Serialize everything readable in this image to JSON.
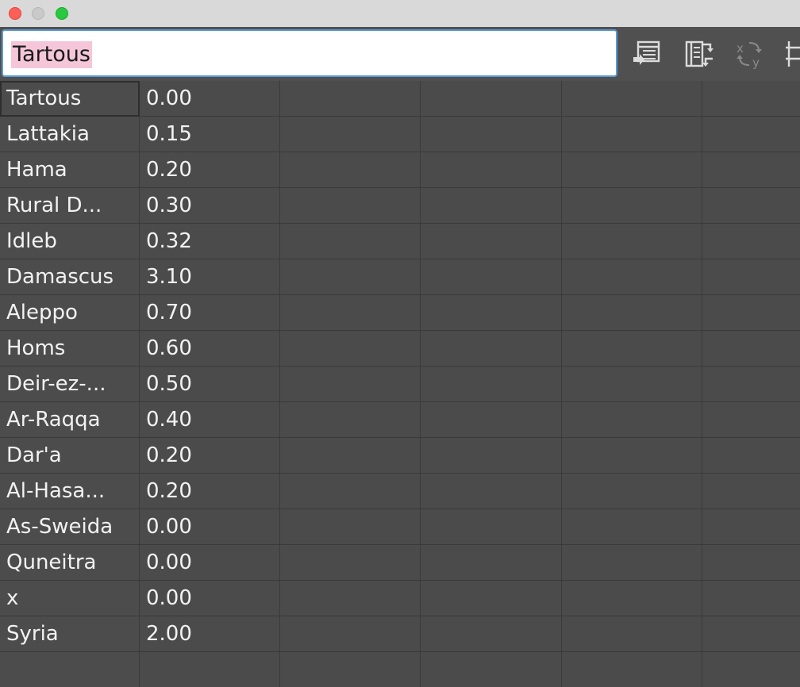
{
  "toolbar": {
    "input_value": "Tartous",
    "buttons": [
      {
        "name": "insert-table-icon"
      },
      {
        "name": "transpose-table-icon"
      },
      {
        "name": "swap-xy-icon"
      },
      {
        "name": "move-columns-icon"
      }
    ]
  },
  "table": {
    "rows": [
      {
        "name": "Tartous",
        "value": "0.00"
      },
      {
        "name": "Lattakia",
        "value": "0.15"
      },
      {
        "name": "Hama",
        "value": "0.20"
      },
      {
        "name": "Rural D...",
        "value": "0.30"
      },
      {
        "name": "Idleb",
        "value": "0.32"
      },
      {
        "name": "Damascus",
        "value": "3.10"
      },
      {
        "name": "Aleppo",
        "value": "0.70"
      },
      {
        "name": "Homs",
        "value": "0.60"
      },
      {
        "name": "Deir-ez-...",
        "value": "0.50"
      },
      {
        "name": "Ar-Raqqa",
        "value": "0.40"
      },
      {
        "name": "Dar'a",
        "value": "0.20"
      },
      {
        "name": "Al-Hasa...",
        "value": "0.20"
      },
      {
        "name": "As-Sweida",
        "value": "0.00"
      },
      {
        "name": "Quneitra",
        "value": "0.00"
      },
      {
        "name": "x",
        "value": "0.00"
      },
      {
        "name": "Syria",
        "value": "2.00"
      },
      {
        "name": "",
        "value": ""
      }
    ]
  }
}
